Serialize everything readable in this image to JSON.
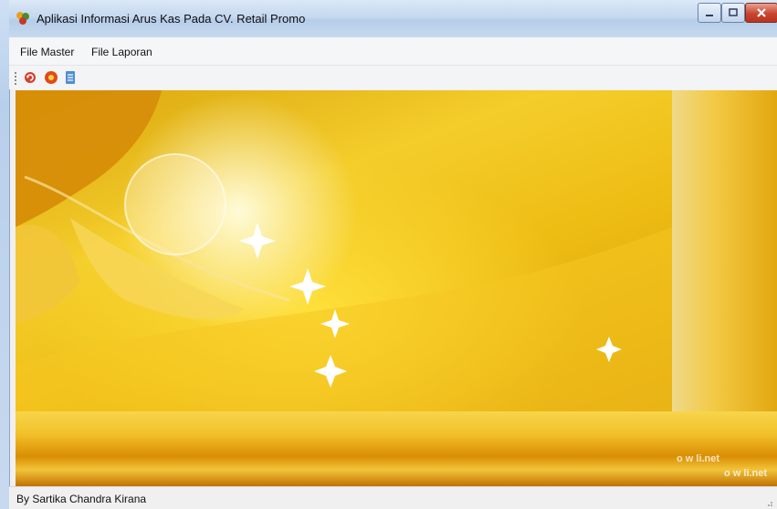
{
  "window": {
    "title": "Aplikasi Informasi Arus Kas Pada CV. Retail Promo",
    "controls": {
      "minimize_icon": "minimize-icon",
      "maximize_icon": "maximize-icon",
      "close_icon": "close-icon"
    }
  },
  "menu": {
    "items": [
      {
        "label": "File Master"
      },
      {
        "label": "File Laporan"
      }
    ]
  },
  "toolbar": {
    "buttons": [
      {
        "icon": "refresh-icon"
      },
      {
        "icon": "stop-icon"
      },
      {
        "icon": "document-icon"
      }
    ]
  },
  "background": {
    "watermark": "o w    li.net",
    "accent_colors": [
      "#f0c21a",
      "#e2a507",
      "#ffe03b"
    ]
  },
  "status": {
    "text": "By Sartika Chandra Kirana"
  }
}
